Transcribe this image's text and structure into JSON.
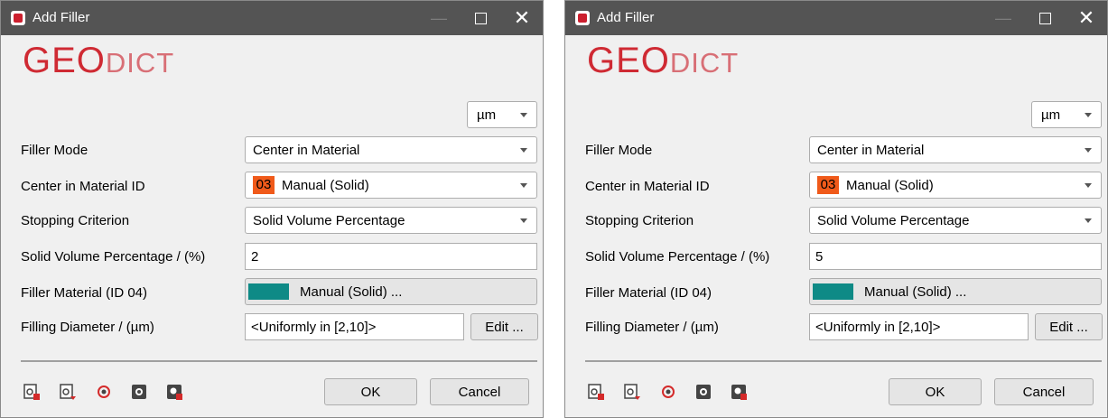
{
  "dialogs": [
    {
      "title": "Add Filler",
      "logo": {
        "geo": "GEO",
        "dict": "DICT"
      },
      "unit": "µm",
      "filler_mode": {
        "label": "Filler Mode",
        "value": "Center in Material"
      },
      "center_material": {
        "label": "Center in Material ID",
        "badge": "03",
        "value": "Manual (Solid)"
      },
      "stopping": {
        "label": "Stopping Criterion",
        "value": "Solid Volume Percentage"
      },
      "solid_volume": {
        "label": "Solid Volume Percentage / (%)",
        "value": "2"
      },
      "filler_material": {
        "label": "Filler Material (ID 04)",
        "value": "Manual (Solid) ...",
        "swatch_color": "#0e8a86"
      },
      "filling_diameter": {
        "label": "Filling Diameter / (µm)",
        "value": "<Uniformly in [2,10]>",
        "edit": "Edit ..."
      },
      "buttons": {
        "ok": "OK",
        "cancel": "Cancel"
      }
    },
    {
      "title": "Add Filler",
      "logo": {
        "geo": "GEO",
        "dict": "DICT"
      },
      "unit": "µm",
      "filler_mode": {
        "label": "Filler Mode",
        "value": "Center in Material"
      },
      "center_material": {
        "label": "Center in Material ID",
        "badge": "03",
        "value": "Manual (Solid)"
      },
      "stopping": {
        "label": "Stopping Criterion",
        "value": "Solid Volume Percentage"
      },
      "solid_volume": {
        "label": "Solid Volume Percentage / (%)",
        "value": "5"
      },
      "filler_material": {
        "label": "Filler Material (ID 04)",
        "value": "Manual (Solid) ...",
        "swatch_color": "#0e8a86"
      },
      "filling_diameter": {
        "label": "Filling Diameter / (µm)",
        "value": "<Uniformly in [2,10]>",
        "edit": "Edit ..."
      },
      "buttons": {
        "ok": "OK",
        "cancel": "Cancel"
      }
    }
  ],
  "toolbar_icons": [
    "load-icon",
    "save-icon",
    "refresh-icon",
    "settings-icon",
    "settings-lock-icon"
  ],
  "colors": {
    "titlebar": "#545454",
    "brand": "#cf2a33",
    "material_badge": "#f05a1a",
    "swatch": "#0e8a86"
  }
}
